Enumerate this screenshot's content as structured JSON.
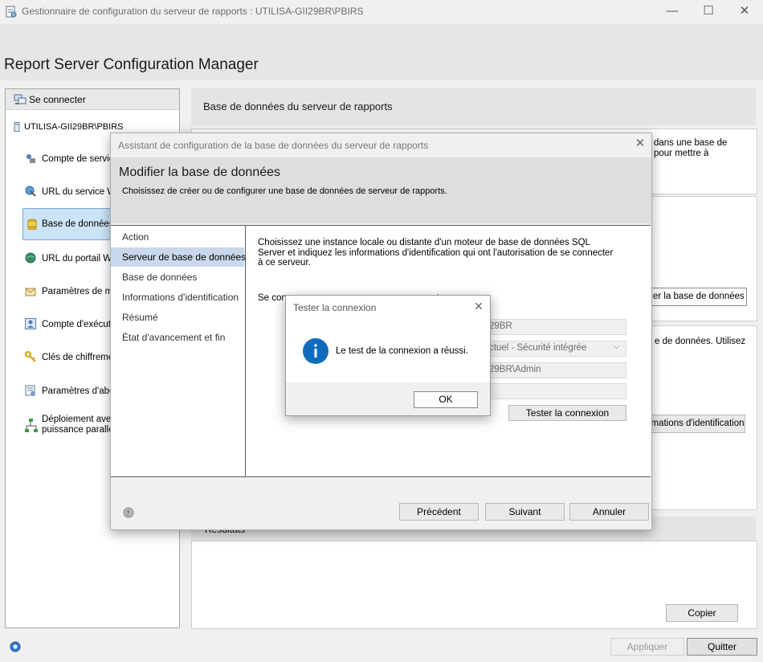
{
  "window": {
    "title": "Gestionnaire de configuration du serveur de rapports : UTILISA-GII29BR\\PBIRS",
    "controls": {
      "minimize": "—",
      "maximize": "☐",
      "close": "✕"
    }
  },
  "app": {
    "title": "Report Server Configuration Manager"
  },
  "sidebar": {
    "connect_label": "Se connecter",
    "server_name": "UTILISA-GII29BR\\PBIRS",
    "items": [
      {
        "label": "Compte de service",
        "icon": "service-account-icon"
      },
      {
        "label": "URL du service Web",
        "icon": "web-url-icon"
      },
      {
        "label": "Base de données",
        "icon": "database-icon"
      },
      {
        "label": "URL du portail Web",
        "icon": "globe-icon"
      },
      {
        "label": "Paramètres de messagerie",
        "icon": "mail-icon"
      },
      {
        "label": "Compte d'exécution",
        "icon": "user-account-icon"
      },
      {
        "label": "Clés de chiffrement",
        "icon": "key-icon"
      },
      {
        "label": "Paramètres d'abonnement",
        "icon": "subscription-icon"
      },
      {
        "label_line1": "Déploiement avec",
        "label_line2": "puissance parallèle",
        "icon": "scale-out-icon"
      }
    ]
  },
  "main": {
    "header": "Base de données du serveur de rapports",
    "intro_fragment_1": "dans une base de",
    "intro_fragment_2": "pour mettre à",
    "change_db_button": "fier la base de données",
    "creds_fragment": "e de données. Utilisez",
    "creds_button": "mations d'identification",
    "results_label": "Résultats",
    "copy_button": "Copier",
    "apply_button": "Appliquer",
    "quit_button": "Quitter"
  },
  "wizard": {
    "title": "Assistant de configuration de la base de données du serveur de rapports",
    "heading": "Modifier la base de données",
    "subheading": "Choisissez de créer ou de configurer une base de données de serveur de rapports.",
    "steps": [
      "Action",
      "Serveur de base de données",
      "Base de données",
      "Informations d'identification",
      "Résumé",
      "État d'avancement et fin"
    ],
    "selected_step": 1,
    "description": "Choisissez une instance locale ou distante d'un moteur de base de données SQL Server et indiquez les informations d'identification qui ont l'autorisation de se connecter à ce serveur.",
    "connect_fragment": "Se con",
    "connect_fragment_2": "urant",
    "server_value_fragment": "29BR",
    "auth_value_fragment": "ctuel - Sécurité intégrée",
    "user_value_fragment": "29BR\\Admin",
    "test_button": "Tester la connexion",
    "prev_button": "Précédent",
    "next_button": "Suivant",
    "cancel_button": "Annuler"
  },
  "dialog": {
    "title": "Tester la connexion",
    "message": "Le test de la connexion a réussi.",
    "ok_button": "OK"
  },
  "colors": {
    "accent_blue": "#0f6cbd",
    "selection": "#cce4f7",
    "wizard_step_selected": "#c9d8ea"
  }
}
